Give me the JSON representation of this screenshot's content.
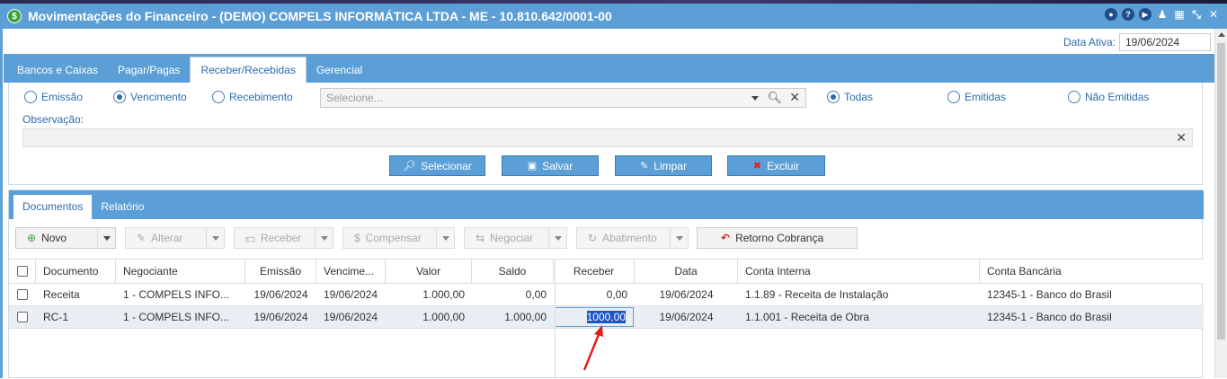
{
  "window": {
    "title": "Movimentações do Financeiro - (DEMO) COMPELS INFORMÁTICA LTDA - ME - 10.810.642/0001-00"
  },
  "date_bar": {
    "label": "Data Ativa:",
    "value": "19/06/2024"
  },
  "main_tabs": [
    {
      "label": "Bancos e Caixas"
    },
    {
      "label": "Pagar/Pagas"
    },
    {
      "label": "Receber/Recebidas"
    },
    {
      "label": "Gerencial"
    }
  ],
  "filters": {
    "date_type": [
      {
        "label": "Emissão",
        "selected": false
      },
      {
        "label": "Vencimento",
        "selected": true
      },
      {
        "label": "Recebimento",
        "selected": false
      }
    ],
    "select_placeholder": "Selecione...",
    "emission": [
      {
        "label": "Todas",
        "selected": true
      },
      {
        "label": "Emitidas",
        "selected": false
      },
      {
        "label": "Não Emitidas",
        "selected": false
      }
    ],
    "obs_label": "Observação:",
    "obs_value": ""
  },
  "actions": {
    "select": "Selecionar",
    "save": "Salvar",
    "clear": "Limpar",
    "delete": "Excluir"
  },
  "sub_tabs": [
    {
      "label": "Documentos"
    },
    {
      "label": "Relatório"
    }
  ],
  "toolbar": {
    "novo": "Novo",
    "alterar": "Alterar",
    "receber": "Receber",
    "compensar": "Compensar",
    "negociar": "Negociar",
    "abatimento": "Abatimento",
    "retorno": "Retorno Cobrança"
  },
  "table": {
    "headers": [
      "Documento",
      "Negociante",
      "Emissão",
      "Vencime...",
      "Valor",
      "Saldo",
      "Receber",
      "Data",
      "Conta Interna",
      "Conta Bancária"
    ],
    "rows": [
      [
        "Receita",
        "1 - COMPELS INFO...",
        "19/06/2024",
        "19/06/2024",
        "1.000,00",
        "0,00",
        "0,00",
        "19/06/2024",
        "1.1.89 - Receita de Instalação",
        "12345-1 - Banco do Brasil"
      ],
      [
        "RC-1",
        "1 - COMPELS INFO...",
        "19/06/2024",
        "19/06/2024",
        "1.000,00",
        "1.000,00",
        "1000,00",
        "19/06/2024",
        "1.1.001 - Receita de Obra",
        "12345-1 - Banco do Brasil"
      ]
    ]
  },
  "colors": {
    "accent": "#5c9fd6",
    "text_blue": "#2b6cb0",
    "annotation": "#e0201b"
  }
}
